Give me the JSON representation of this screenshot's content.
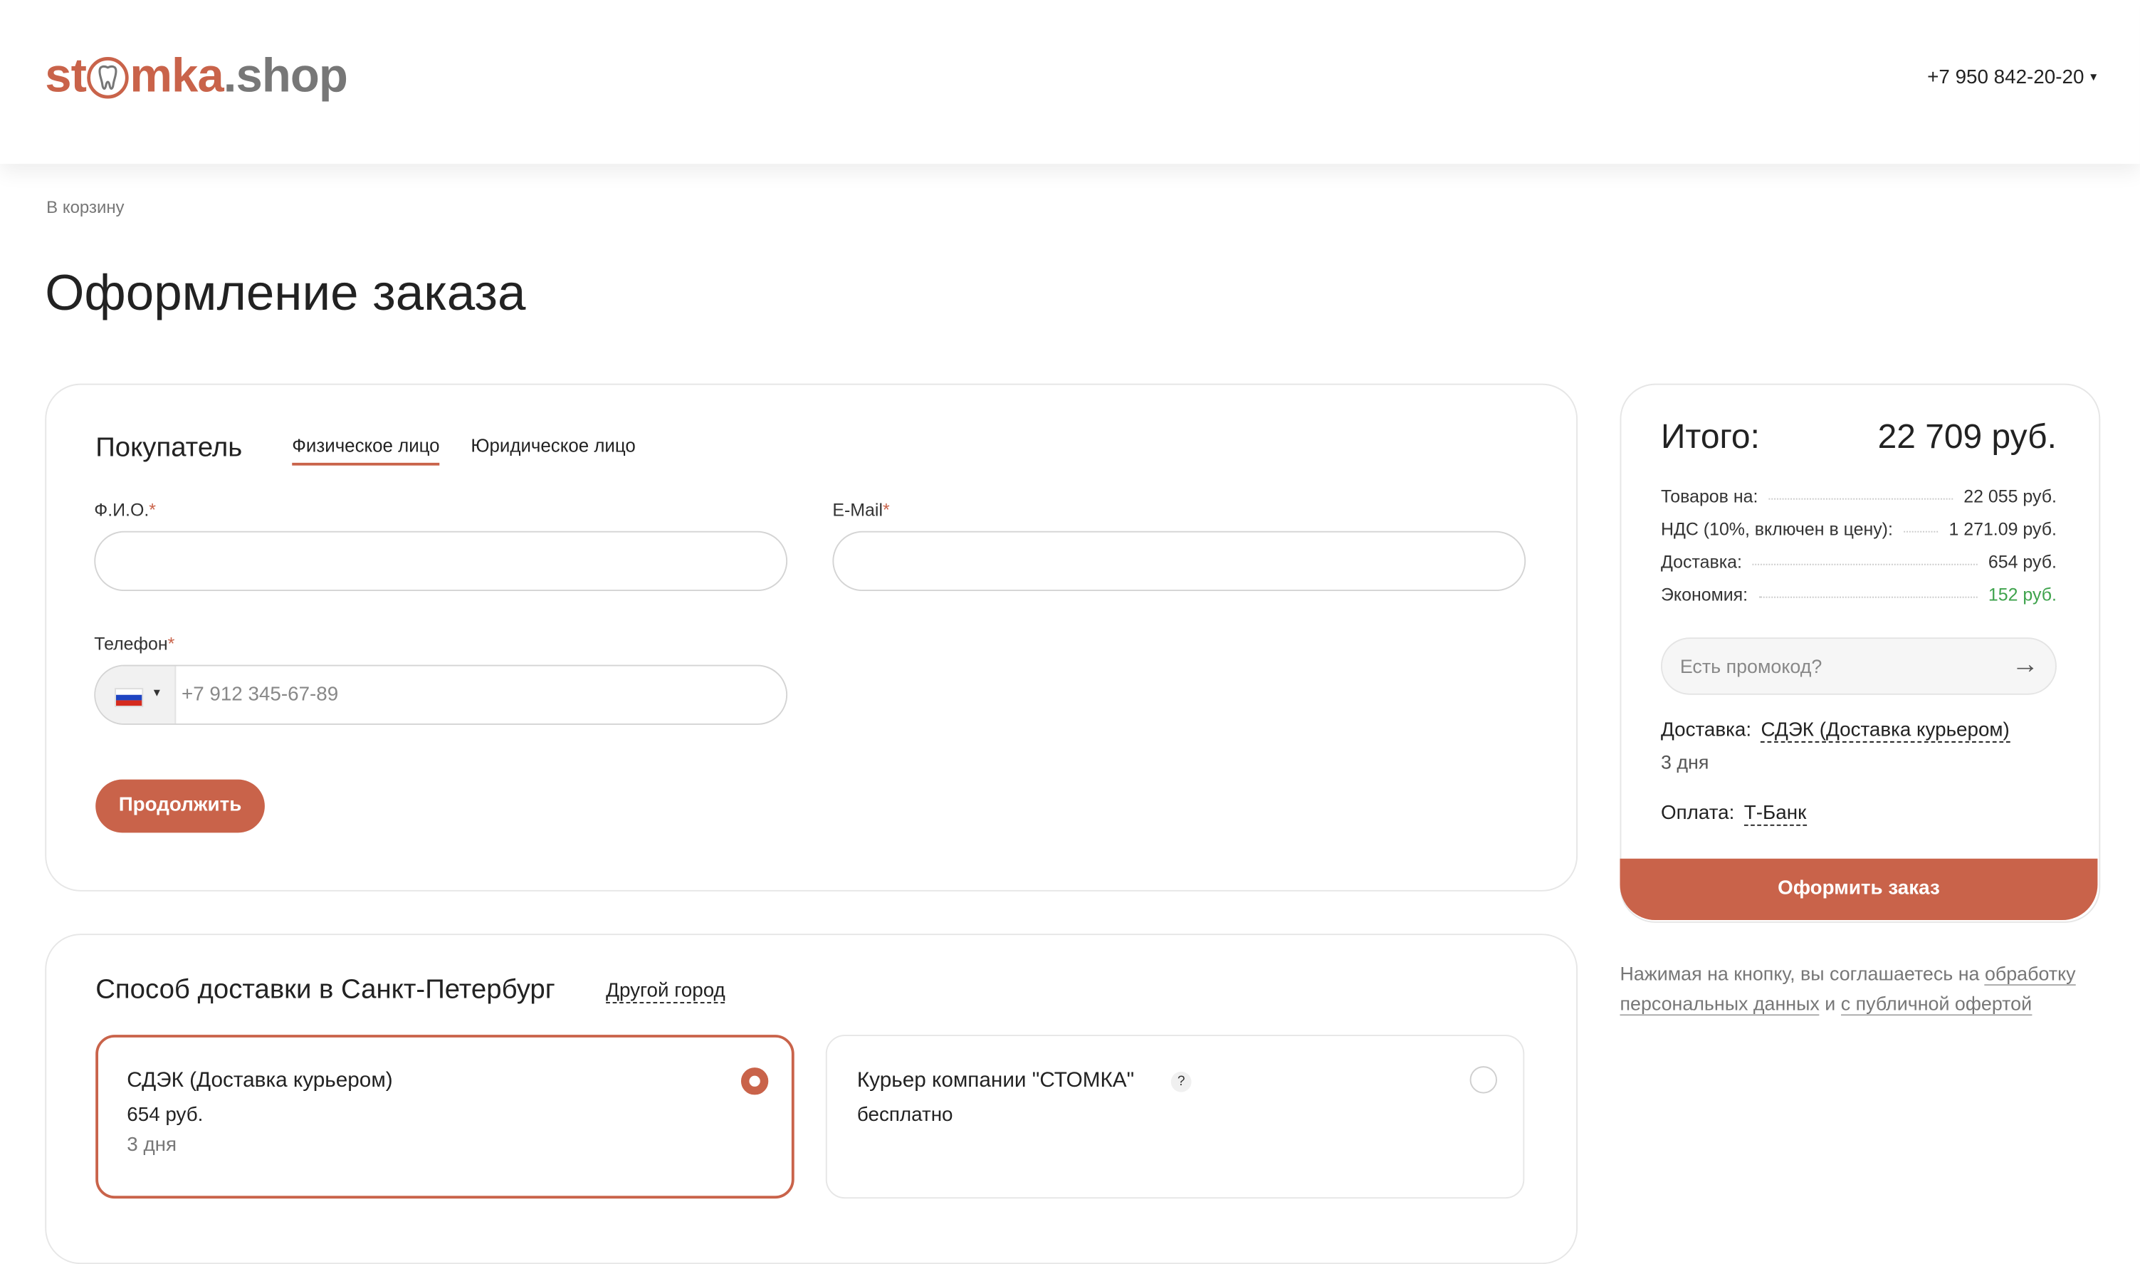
{
  "header": {
    "logo_part1": "st",
    "logo_part2": "mka",
    "logo_part3": ".shop",
    "phone": "+7 950 842-20-20"
  },
  "breadcrumb": "В корзину",
  "page_title": "Оформление заказа",
  "buyer": {
    "title": "Покупатель",
    "tabs": [
      "Физическое лицо",
      "Юридическое лицо"
    ],
    "active_tab": 0,
    "fio_label": "Ф.И.О.",
    "email_label": "E-Mail",
    "phone_label": "Телефон",
    "required_mark": "*",
    "phone_placeholder": "+7 912 345-67-89",
    "continue_button": "Продолжить"
  },
  "summary": {
    "title": "Итого:",
    "total": "22 709 руб.",
    "rows": [
      {
        "label": "Товаров на:",
        "value": "22 055 руб."
      },
      {
        "label": "НДС (10%, включен в цену):",
        "value": "1 271.09 руб."
      },
      {
        "label": "Доставка:",
        "value": "654 руб."
      },
      {
        "label": "Экономия:",
        "value": "152 руб."
      }
    ],
    "promo_placeholder": "Есть промокод?",
    "delivery_label": "Доставка:",
    "delivery_value": "СДЭК (Доставка курьером)",
    "delivery_days": "3 дня",
    "payment_label": "Оплата:",
    "payment_value": "Т-Банк",
    "order_button": "Оформить заказ",
    "agree_text_1": "Нажимая на кнопку, вы соглашаетесь на",
    "agree_link_1": "обработку персональных данных",
    "agree_and": "и",
    "agree_link_2": "с публичной офертой",
    "economy_color": "#3fa34d"
  },
  "delivery": {
    "title": "Способ доставки в Санкт-Петербург",
    "other_city": "Другой город",
    "options": [
      {
        "title": "СДЭК (Доставка курьером)",
        "price": "654 руб.",
        "days": "3 дня",
        "selected": true
      },
      {
        "title": "Курьер компании \"СТОМКА\"",
        "price": "бесплатно",
        "help": "?",
        "selected": false
      }
    ]
  },
  "colors": {
    "accent": "#c9634a"
  }
}
